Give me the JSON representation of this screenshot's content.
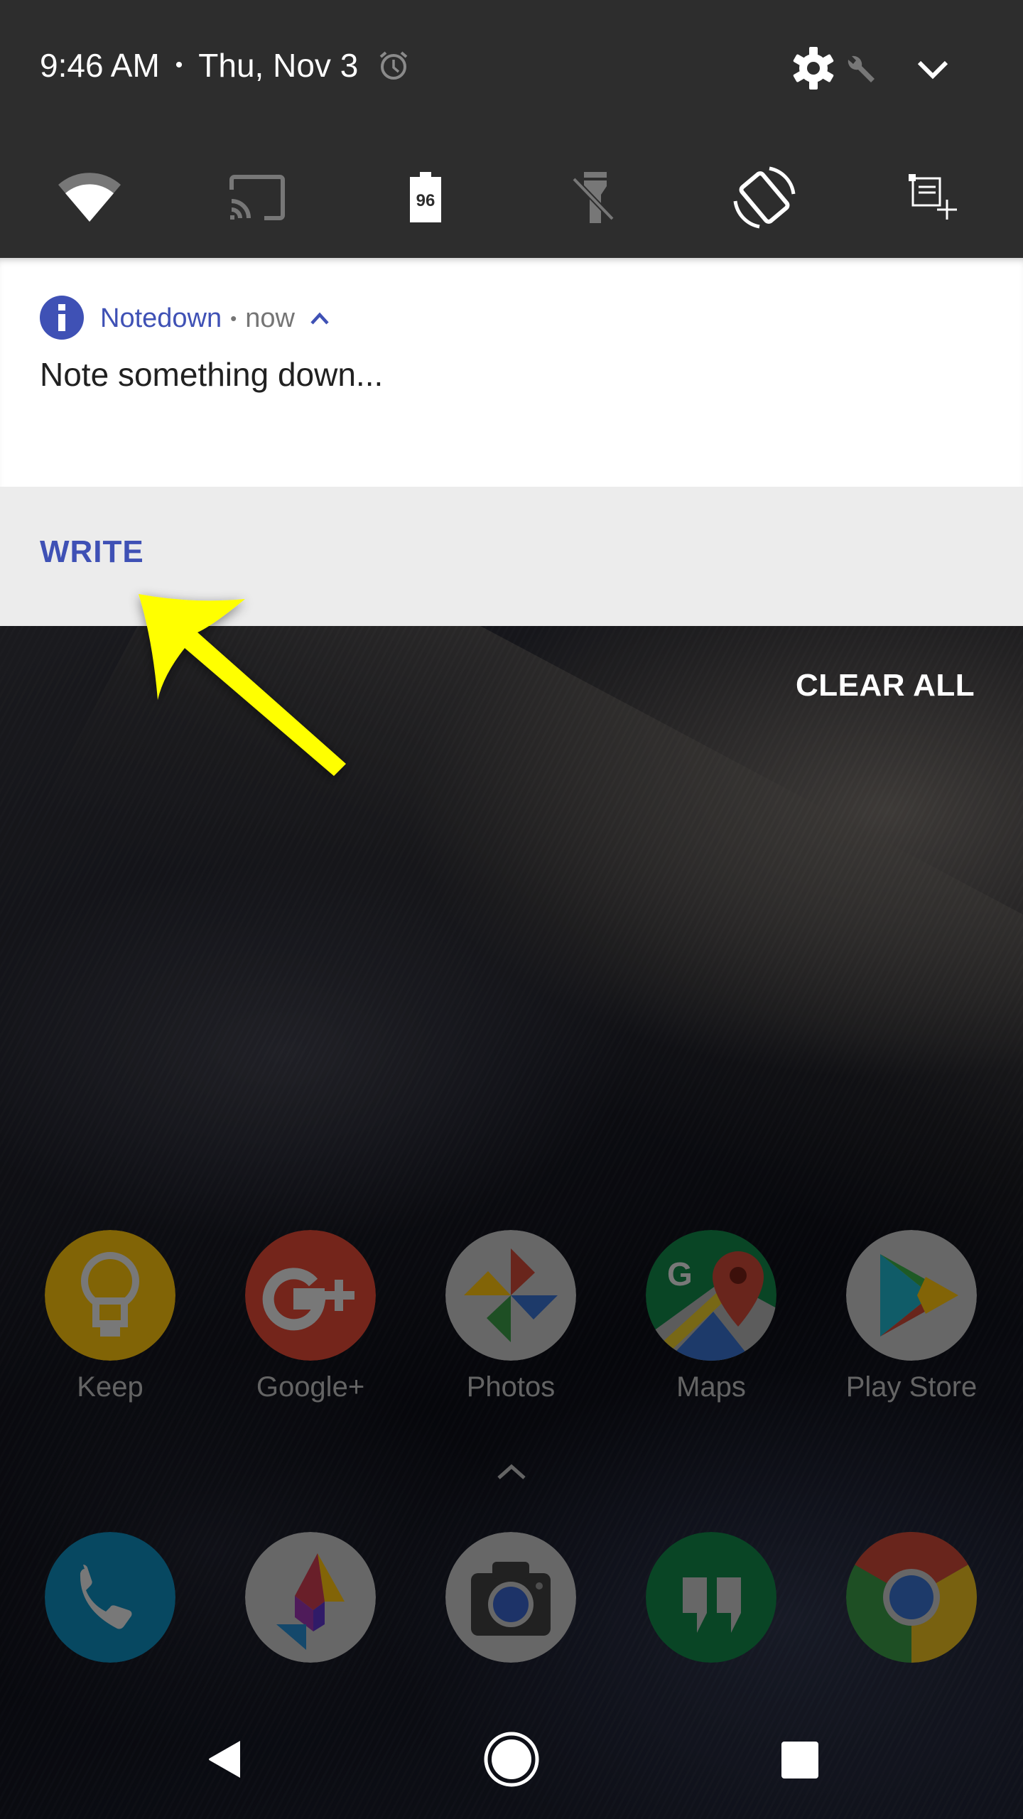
{
  "status": {
    "time": "9:46 AM",
    "separator": "•",
    "date": "Thu, Nov 3",
    "alarm_icon": "alarm-clock-icon",
    "settings_icon": "gear-icon",
    "system_ui_tuner_icon": "wrench-icon",
    "expand_icon": "chevron-down-icon"
  },
  "quick_settings": [
    {
      "name": "wifi",
      "icon": "wifi-icon",
      "state": "on"
    },
    {
      "name": "cast",
      "icon": "cast-icon",
      "state": "off"
    },
    {
      "name": "battery",
      "icon": "battery-icon",
      "value": "96"
    },
    {
      "name": "flashlight",
      "icon": "flashlight-off-icon",
      "state": "off"
    },
    {
      "name": "auto-rotate",
      "icon": "screen-rotation-icon",
      "state": "on"
    },
    {
      "name": "notedown-tile",
      "icon": "add-note-tile-icon",
      "state": "on"
    }
  ],
  "notification": {
    "app_icon": "info-icon",
    "app_name": "Notedown",
    "separator": "•",
    "time": "now",
    "collapse_icon": "chevron-up-icon",
    "text": "Note something down...",
    "action_label": "WRITE",
    "accent": "#3f51b5"
  },
  "clear_all_label": "CLEAR ALL",
  "home_apps": [
    {
      "label": "Keep",
      "color": "#c79a0a"
    },
    {
      "label": "Google+",
      "color": "#b23a2a"
    },
    {
      "label": "Photos",
      "color": "#9e9e9e"
    },
    {
      "label": "Maps",
      "color": "#0e6b3a"
    },
    {
      "label": "Play Store",
      "color": "#9e9e9e"
    }
  ],
  "dock_apps": [
    {
      "label": "Phone",
      "color": "#0b6f95"
    },
    {
      "label": "Pixel Launcher Swap",
      "color": "#9e9e9e"
    },
    {
      "label": "Camera",
      "color": "#9e9e9e"
    },
    {
      "label": "Hangouts",
      "color": "#0e6b3a"
    },
    {
      "label": "Chrome",
      "color": "#9e9e9e"
    }
  ],
  "nav": {
    "back_icon": "back-triangle-icon",
    "home_icon": "home-circle-icon",
    "recents_icon": "recents-square-icon"
  },
  "annotation": {
    "color": "#ffff00",
    "points_to": "WRITE"
  }
}
